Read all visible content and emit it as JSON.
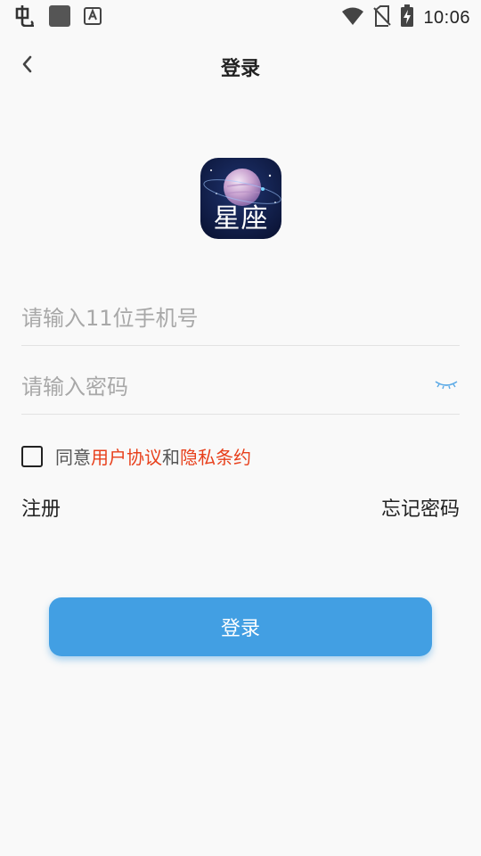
{
  "status_bar": {
    "time": "10:06",
    "icons": [
      "bug-icon",
      "app-square-icon",
      "keyboard-a-icon",
      "wifi-icon",
      "no-sim-icon",
      "battery-charging-icon"
    ]
  },
  "header": {
    "title": "登录",
    "back_icon": "chevron-left-icon"
  },
  "logo": {
    "text": "星座",
    "icon": "planet-logo-icon"
  },
  "form": {
    "phone_placeholder": "请输入11位手机号",
    "phone_value": "",
    "password_placeholder": "请输入密码",
    "password_value": "",
    "password_toggle_icon": "eye-closed-icon"
  },
  "agreement": {
    "checked": false,
    "prefix": "同意",
    "user_agreement": "用户协议",
    "and": "和",
    "privacy_policy": "隐私条约"
  },
  "links": {
    "register": "注册",
    "forgot_password": "忘记密码"
  },
  "login_button": {
    "label": "登录"
  },
  "colors": {
    "background": "#f9f9f9",
    "accent": "#429fe3",
    "link_red": "#e8401c"
  }
}
